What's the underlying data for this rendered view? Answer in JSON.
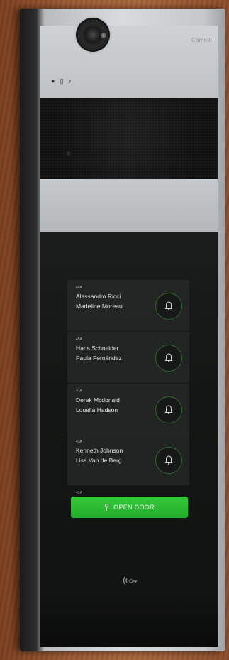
{
  "device": {
    "brand": "Comelit",
    "status_icons": [
      "bell-status-icon",
      "door-status-icon",
      "audio-status-icon"
    ]
  },
  "residents": [
    {
      "apartment": "46A",
      "names": [
        "Alessandro Ricci",
        "Madeline Moreau"
      ]
    },
    {
      "apartment": "45A",
      "names": [
        "Hans Schneider",
        "Paula Fernández"
      ]
    },
    {
      "apartment": "44A",
      "names": [
        "Derek Mcdonald",
        "Louella  Hadson"
      ]
    },
    {
      "apartment": "43A",
      "names": [
        "Kenneth Johnson",
        "Lisa Van de Berg"
      ]
    }
  ],
  "next_apartment_label": "42A",
  "open_door": {
    "label": "OPEN DOOR",
    "color": "#2fbf35"
  },
  "colors": {
    "wall": "#a0603a",
    "frame": "#c9ccce",
    "screen": "#141615",
    "bell_ring": "#2f6a2a"
  }
}
